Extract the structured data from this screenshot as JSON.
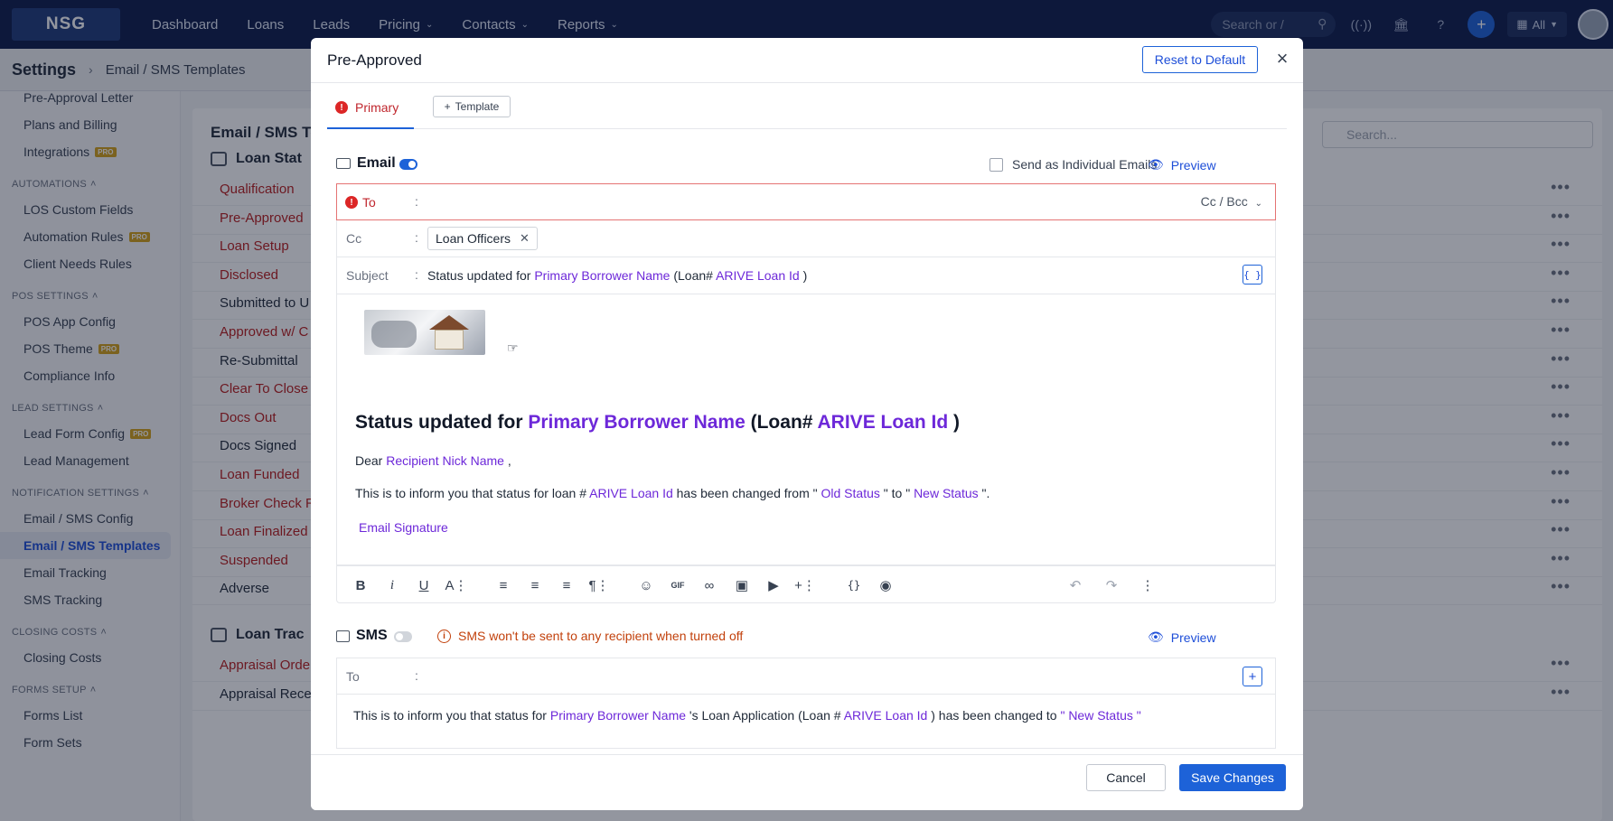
{
  "topnav": {
    "logo": "NSG",
    "items": [
      {
        "label": "Dashboard",
        "dropdown": false
      },
      {
        "label": "Loans",
        "dropdown": false
      },
      {
        "label": "Leads",
        "dropdown": false
      },
      {
        "label": "Pricing",
        "dropdown": true
      },
      {
        "label": "Contacts",
        "dropdown": true
      },
      {
        "label": "Reports",
        "dropdown": true
      }
    ],
    "search_placeholder": "Search or /",
    "all_label": "All"
  },
  "subheader": {
    "title": "Settings",
    "breadcrumb": "Email / SMS Templates"
  },
  "sidebar": {
    "top_items": [
      {
        "label": "Pre-Approval Letter",
        "pro": false
      },
      {
        "label": "Plans and Billing",
        "pro": false
      },
      {
        "label": "Integrations",
        "pro": true
      }
    ],
    "sections": [
      {
        "title": "AUTOMATIONS",
        "items": [
          {
            "label": "LOS Custom Fields",
            "pro": false
          },
          {
            "label": "Automation Rules",
            "pro": true
          },
          {
            "label": "Client Needs Rules",
            "pro": false
          }
        ]
      },
      {
        "title": "POS SETTINGS",
        "items": [
          {
            "label": "POS App Config",
            "pro": false
          },
          {
            "label": "POS Theme",
            "pro": true
          },
          {
            "label": "Compliance Info",
            "pro": false
          }
        ]
      },
      {
        "title": "LEAD SETTINGS",
        "items": [
          {
            "label": "Lead Form Config",
            "pro": true
          },
          {
            "label": "Lead Management",
            "pro": false
          }
        ]
      },
      {
        "title": "NOTIFICATION SETTINGS",
        "items": [
          {
            "label": "Email / SMS Config",
            "pro": false
          },
          {
            "label": "Email / SMS Templates",
            "pro": false,
            "active": true
          },
          {
            "label": "Email Tracking",
            "pro": false
          },
          {
            "label": "SMS Tracking",
            "pro": false
          }
        ]
      },
      {
        "title": "CLOSING COSTS",
        "items": [
          {
            "label": "Closing Costs",
            "pro": false
          }
        ]
      },
      {
        "title": "FORMS SETUP",
        "items": [
          {
            "label": "Forms List",
            "pro": false
          },
          {
            "label": "Form Sets",
            "pro": false
          }
        ]
      }
    ],
    "pro_badge": "PRO"
  },
  "main": {
    "title": "Email / SMS Te",
    "search_placeholder": "Search...",
    "group1": "Loan Stat",
    "group2": "Loan Trac",
    "rows1": [
      {
        "name": "Qualification",
        "red": true
      },
      {
        "name": "Pre-Approved",
        "red": true
      },
      {
        "name": "Loan Setup",
        "red": true
      },
      {
        "name": "Disclosed",
        "red": true
      },
      {
        "name": "Submitted to U",
        "red": false
      },
      {
        "name": "Approved w/ C",
        "red": true
      },
      {
        "name": "Re-Submittal",
        "red": false
      },
      {
        "name": "Clear To Close",
        "red": true
      },
      {
        "name": "Docs Out",
        "red": true
      },
      {
        "name": "Docs Signed",
        "red": false
      },
      {
        "name": "Loan Funded",
        "red": true
      },
      {
        "name": "Broker Check R",
        "red": true
      },
      {
        "name": "Loan Finalized",
        "red": true
      },
      {
        "name": "Suspended",
        "red": true
      },
      {
        "name": "Adverse",
        "red": false
      }
    ],
    "rows2": [
      {
        "name": "Appraisal Orde",
        "red": true
      },
      {
        "name": "Appraisal Rece",
        "red": false
      }
    ]
  },
  "modal": {
    "title": "Pre-Approved",
    "reset_label": "Reset to Default",
    "close_icon": "×",
    "tabs": {
      "primary": "Primary",
      "template": "Template"
    },
    "email": {
      "label": "Email",
      "enabled": true,
      "individual_label": "Send as Individual Emails",
      "preview_label": "Preview",
      "to_label": "To",
      "cc_label": "Cc",
      "subject_label": "Subject",
      "colon": ":",
      "cc_bcc": "Cc / Bcc",
      "cc_chip": "Loan Officers",
      "subject": {
        "p1": "Status updated for ",
        "v1": "Primary Borrower Name",
        "p2": " (Loan# ",
        "v2": "ARIVE Loan Id",
        "p3": " )"
      },
      "body": {
        "heading_p1": "Status updated for ",
        "heading_v1": "Primary Borrower Name",
        "heading_p2": " (Loan# ",
        "heading_v2": "ARIVE Loan Id",
        "heading_p3": " )",
        "dear": "Dear ",
        "dear_var": "Recipient Nick Name",
        "dear_end": " ,",
        "info_p1": "This is to inform you that status for loan # ",
        "info_v1": "ARIVE Loan Id",
        "info_p2": " has been changed from \" ",
        "info_v2": "Old Status",
        "info_p3": " \" to \" ",
        "info_v3": "New Status",
        "info_p4": " \".",
        "signature": "Email Signature"
      }
    },
    "sms": {
      "label": "SMS",
      "enabled": false,
      "warning": "SMS won't be sent to any recipient when turned off",
      "preview_label": "Preview",
      "to_label": "To",
      "body": {
        "p1": "This is to inform you that status for ",
        "v1": "Primary Borrower Name",
        "p2": " 's Loan Application (Loan # ",
        "v2": "ARIVE Loan Id",
        "p3": " ) has been changed to ",
        "v3": "\" New Status \""
      }
    },
    "footer": {
      "cancel": "Cancel",
      "save": "Save Changes"
    }
  },
  "colors": {
    "primary": "#1d62d8",
    "variable": "#6d28d9",
    "error": "#dc2626",
    "warning": "#c2410c",
    "nav_bg": "#0b1a4a"
  }
}
